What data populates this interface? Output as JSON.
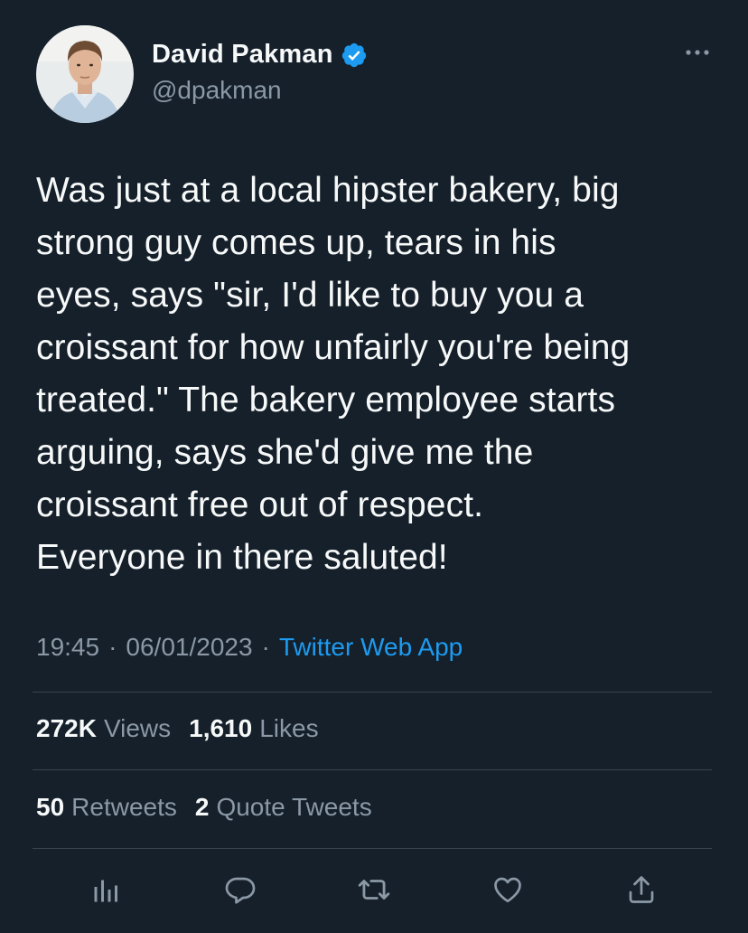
{
  "author": {
    "display_name": "David Pakman",
    "handle": "@dpakman",
    "verified": true
  },
  "tweet": {
    "text": "Was just at a local hipster bakery, big\nstrong guy comes up, tears in his\neyes, says \"sir, I'd like to buy you a\ncroissant for how unfairly you're being\ntreated.\" The bakery employee starts\narguing, says she'd give me the\ncroissant free out of respect.\nEveryone in there saluted!",
    "time": "19:45",
    "date": "06/01/2023",
    "separator": "·",
    "source": "Twitter Web App"
  },
  "stats": {
    "views_count": "272K",
    "views_label": "Views",
    "likes_count": "1,610",
    "likes_label": "Likes",
    "retweets_count": "50",
    "retweets_label": "Retweets",
    "quotes_count": "2",
    "quotes_label": "Quote Tweets"
  },
  "actions": [
    "analytics-icon",
    "reply-icon",
    "retweet-icon",
    "like-icon",
    "share-icon"
  ],
  "colors": {
    "background": "#15202b",
    "text": "#f7f9f9",
    "muted": "#8b98a5",
    "link": "#1d9bf0",
    "divider": "#38444d",
    "verified": "#1d9bf0"
  }
}
